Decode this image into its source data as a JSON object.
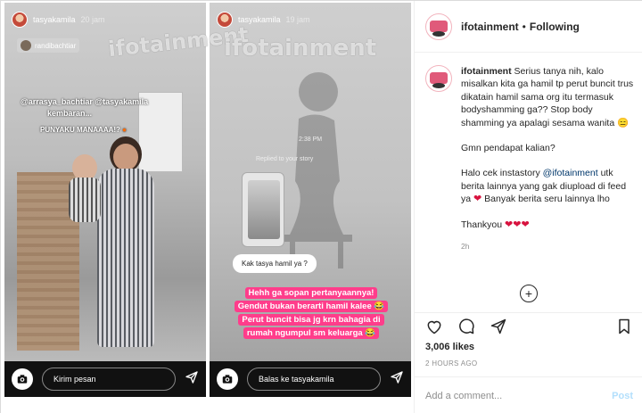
{
  "story1": {
    "username": "tasyakamila",
    "time": "20 jam",
    "tag": "randibachtiar",
    "caption_lines": [
      "@arrasya_bachtiar @tasyakamila",
      "kembaran..."
    ],
    "caption2": "PUNYAKU MANAAAA!?",
    "reply_placeholder": "Kirim pesan"
  },
  "story2": {
    "username": "tasyakamila",
    "time": "19 jam",
    "timestamp": "2:38 PM",
    "replied_label": "Replied to your story",
    "question": "Kak tasya hamil ya ?",
    "answer_lines": [
      "Hehh ga sopan pertanyaannya!",
      "Gendut bukan berarti hamil kalee 😂",
      "Perut buncit bisa jg krn bahagia di",
      "rumah ngumpul sm keluarga 😂"
    ],
    "reply_placeholder": "Balas ke tasyakamila"
  },
  "watermark": "ifotainment",
  "post": {
    "author": "ifotainment",
    "follow_state": "Following",
    "caption_p1": "Serius tanya nih, kalo misalkan kita ga hamil tp perut buncit trus dikatain hamil sama org itu termasuk bodyshamming ga?? Stop body shamming ya apalagi sesama wanita 😑",
    "caption_p2": "Gmn pendapat kalian?",
    "caption_p3a": "Halo cek instastory",
    "caption_p3_mention": "@ifotainment",
    "caption_p3b": "utk berita lainnya yang gak diupload di feed ya",
    "caption_p3c": "Banyak berita seru lainnya lho",
    "caption_p4": "Thankyou",
    "caption_time": "2h",
    "likes": "3,006 likes",
    "ago": "2 HOURS AGO",
    "comment_placeholder": "Add a comment...",
    "post_label": "Post"
  },
  "icons": {
    "heart": "heart-icon",
    "comment": "comment-icon",
    "share": "paper-plane-icon",
    "save": "bookmark-icon",
    "camera": "camera-icon",
    "load_more": "plus-circle-icon"
  },
  "colors": {
    "accent": "#0095f6",
    "post_disabled": "#b2dffc",
    "heart_red": "#d8133f",
    "sticker_pink": "#ff3d8b"
  }
}
